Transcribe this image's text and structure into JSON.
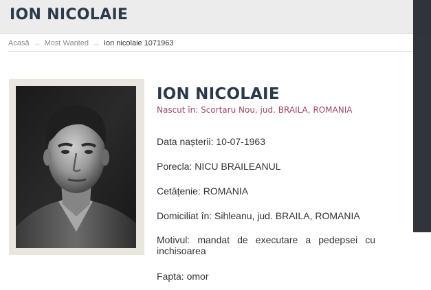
{
  "header": {
    "title": "ION NICOLAIE"
  },
  "breadcrumb": {
    "items": [
      "Acasă",
      "Most Wanted"
    ],
    "current": "Ion nicolaie 1071963",
    "separator": "→"
  },
  "person": {
    "name": "ION NICOLAIE",
    "birthplace": "Nascut în: Scortaru Nou, jud. BRAILA, ROMANIA",
    "photo_alt": "Fotografie Ion Nicolaie",
    "fields": [
      {
        "text": "Data nașterii: 10-07-1963"
      },
      {
        "text": "Porecla: NICU BRAILEANUL"
      },
      {
        "text": "Cetățenie: ROMANIA"
      },
      {
        "text": "Domiciliat în: Sihleanu, jud. BRAILA, ROMANIA"
      }
    ],
    "motiv": "Motivul: mandat de executare a pedepsei cu inchisoarea",
    "fapta": "Fapta: omor"
  },
  "colors": {
    "header_bg": "#ececec",
    "title": "#2b3a4b",
    "accent": "#a3455c",
    "sidebar_bg": "#1e242b"
  }
}
